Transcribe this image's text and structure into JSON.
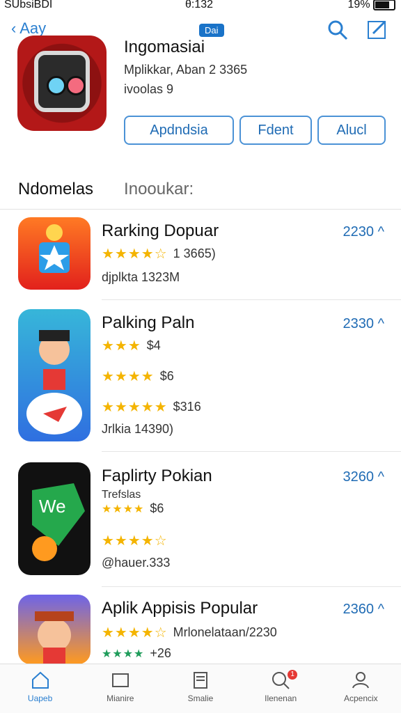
{
  "status": {
    "left": "SUbsiBDI",
    "time": "θ:132",
    "battery": "19%"
  },
  "nav": {
    "back_label": "Aay",
    "badge": "Dai"
  },
  "app": {
    "title": "Ingomasiai",
    "subtitle": "Mplikkar, Aban 2 3365",
    "subtitle2": "ivoolas 9",
    "actions": [
      "Apdndsia",
      "Fdent",
      "Alucl"
    ]
  },
  "sections": {
    "active": "Ndomelas",
    "inactive": "Inooukar:"
  },
  "rows": [
    {
      "title": "Rarking Dopuar",
      "price": "2230",
      "lines": [
        {
          "rating_text": "1 3665)"
        },
        {
          "text": "djplkta 1323M"
        }
      ]
    },
    {
      "title": "Palking Paln",
      "price": "2330",
      "lines": [
        {
          "rating_text": "$4"
        },
        {
          "rating_text": "$6"
        },
        {
          "rating_text": "$316"
        },
        {
          "text": "Jrlkia 14390)"
        }
      ]
    },
    {
      "title": "Faplirty Pokian",
      "price": "3260",
      "lines": [
        {
          "text": "Trefslas"
        },
        {
          "rating_text": "$6"
        },
        {
          "rating_text": ""
        },
        {
          "text": "@hauer.333"
        }
      ]
    },
    {
      "title": "Aplik Appisis Popular",
      "price": "2360",
      "lines": [
        {
          "rating_text": "Mrlonelataan/2230"
        },
        {
          "text": "+26"
        }
      ]
    }
  ],
  "tabs": [
    "Uapeb",
    "Mianire",
    "Smalie",
    "Ilenenan",
    "Acpencix"
  ],
  "colors": {
    "accent": "#2a7fd0",
    "star": "#f4b400"
  }
}
